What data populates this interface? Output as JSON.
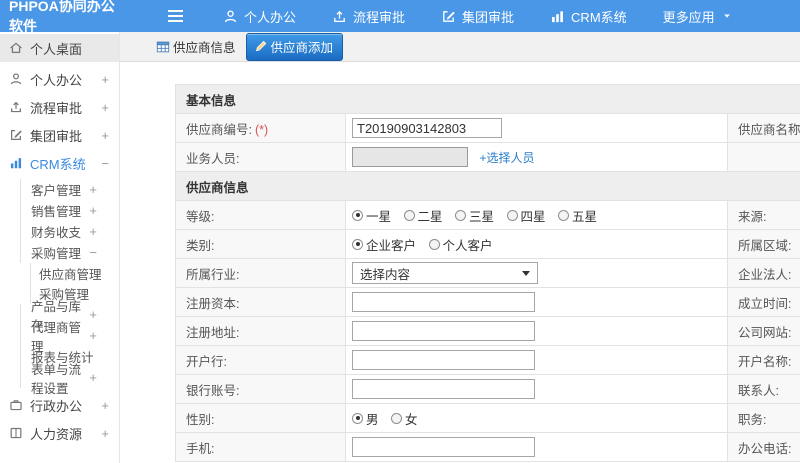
{
  "colors": {
    "topbar": "#4a97e8",
    "accent": "#1a6cc2",
    "link": "#2a7dc9",
    "required": "#d9534f"
  },
  "header": {
    "brand": "PHPOA协同办公软件",
    "menu": [
      {
        "label": "个人办公",
        "icon": "person-icon"
      },
      {
        "label": "流程审批",
        "icon": "upload-icon"
      },
      {
        "label": "集团审批",
        "icon": "edit-icon"
      },
      {
        "label": "CRM系统",
        "icon": "chart-icon"
      },
      {
        "label": "更多应用",
        "icon": "caret-down-icon"
      }
    ]
  },
  "sidebar": {
    "items": [
      {
        "label": "个人桌面",
        "icon": "home-icon",
        "level": 0,
        "active": true,
        "expander": ""
      },
      {
        "label": "个人办公",
        "icon": "person-icon",
        "level": 0,
        "expander": "+"
      },
      {
        "label": "流程审批",
        "icon": "upload-icon",
        "level": 0,
        "expander": "+"
      },
      {
        "label": "集团审批",
        "icon": "edit-icon",
        "level": 0,
        "expander": "+"
      },
      {
        "label": "CRM系统",
        "icon": "chart-icon",
        "level": 0,
        "expander": "−"
      },
      {
        "label": "客户管理",
        "level": 1,
        "expander": "+"
      },
      {
        "label": "销售管理",
        "level": 1,
        "expander": "+"
      },
      {
        "label": "财务收支",
        "level": 1,
        "expander": "+"
      },
      {
        "label": "采购管理",
        "level": 1,
        "expander": "−"
      },
      {
        "label": "供应商管理",
        "level": 2,
        "expander": ""
      },
      {
        "label": "采购管理",
        "level": 2,
        "expander": ""
      },
      {
        "label": "产品与库存",
        "level": 1,
        "expander": "+"
      },
      {
        "label": "代理商管理",
        "level": 1,
        "expander": "+"
      },
      {
        "label": "报表与统计",
        "level": 1,
        "expander": ""
      },
      {
        "label": "表单与流程设置",
        "level": 1,
        "expander": "+"
      },
      {
        "label": "行政办公",
        "icon": "briefcase-icon",
        "level": 0,
        "expander": "+"
      },
      {
        "label": "人力资源",
        "icon": "book-icon",
        "level": 0,
        "expander": "+"
      }
    ]
  },
  "tabs": {
    "info_label": "供应商信息",
    "add_label": "供应商添加"
  },
  "form": {
    "section_basic": "基本信息",
    "section_supplier": "供应商信息",
    "req": "(*)",
    "supplier_code": {
      "label": "供应商编号:",
      "value": "T20190903142803"
    },
    "supplier_name_label": "供应商名称:",
    "business_person": {
      "label": "业务人员:",
      "link": "+选择人员"
    },
    "grade": {
      "label": "等级:",
      "opts": [
        "一星",
        "二星",
        "三星",
        "四星",
        "五星"
      ],
      "selected": "一星",
      "right": "来源:"
    },
    "category": {
      "label": "类别:",
      "opts": [
        "企业客户",
        "个人客户"
      ],
      "selected": "企业客户",
      "right": "所属区域:"
    },
    "industry": {
      "label": "所属行业:",
      "value": "选择内容",
      "right": "企业法人:"
    },
    "reg_capital": {
      "label": "注册资本:",
      "right": "成立时间:"
    },
    "reg_address": {
      "label": "注册地址:",
      "right": "公司网站:"
    },
    "bank": {
      "label": "开户行:",
      "right": "开户名称:"
    },
    "account": {
      "label": "银行账号:",
      "right": "联系人:"
    },
    "gender": {
      "label": "性别:",
      "opts": [
        "男",
        "女"
      ],
      "selected": "男",
      "right": "职务:"
    },
    "mobile": {
      "label": "手机:",
      "right": "办公电话:"
    }
  }
}
